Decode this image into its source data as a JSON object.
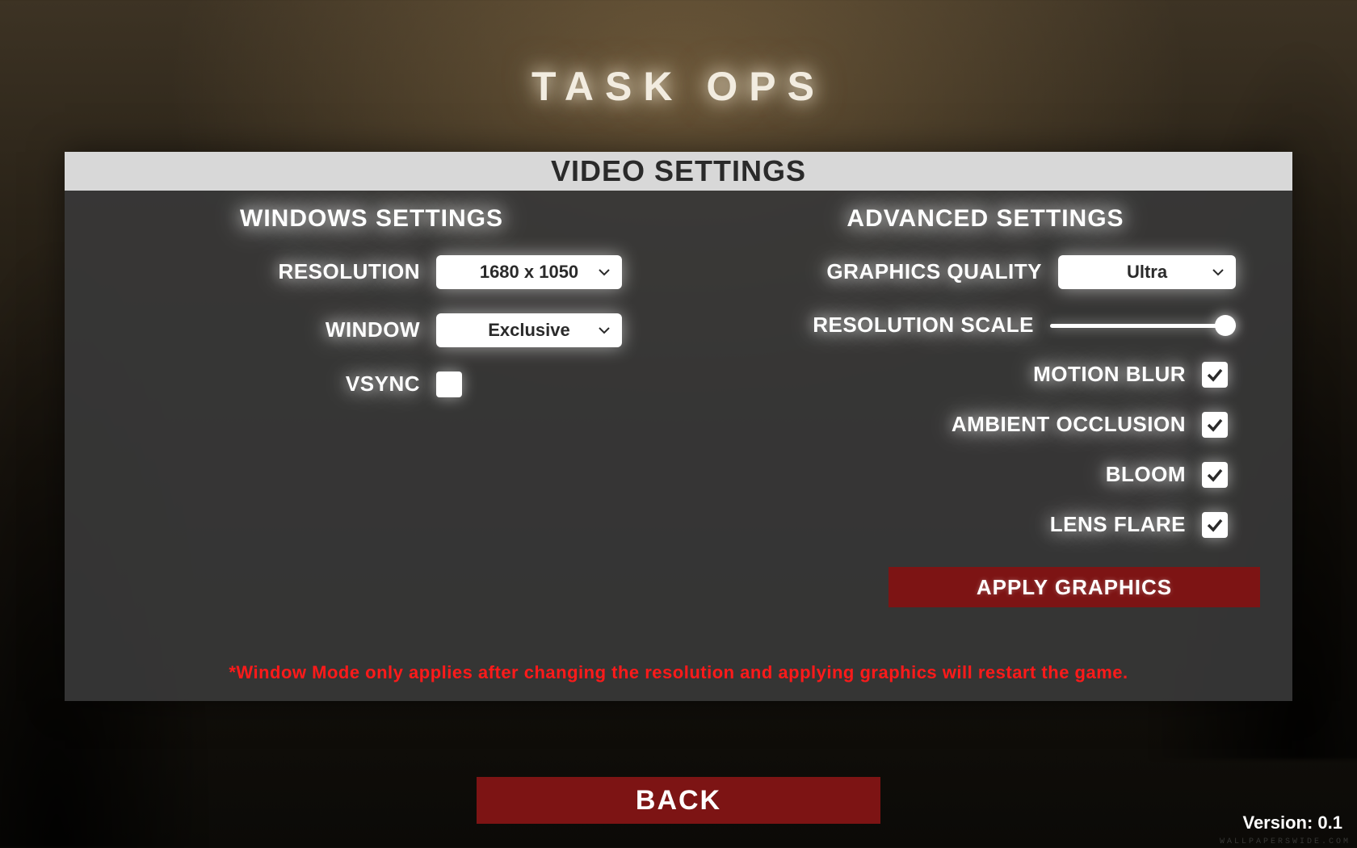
{
  "game_title": "TASK OPS",
  "panel_title": "VIDEO SETTINGS",
  "left": {
    "section": "WINDOWS SETTINGS",
    "resolution": {
      "label": "RESOLUTION",
      "value": "1680 x 1050"
    },
    "window": {
      "label": "WINDOW",
      "value": "Exclusive"
    },
    "vsync": {
      "label": "VSYNC",
      "checked": false
    }
  },
  "right": {
    "section": "ADVANCED SETTINGS",
    "graphics_quality": {
      "label": "GRAPHICS QUALITY",
      "value": "Ultra"
    },
    "resolution_scale": {
      "label": "RESOLUTION SCALE",
      "value": 100,
      "min": 0,
      "max": 100
    },
    "motion_blur": {
      "label": "MOTION BLUR",
      "checked": true
    },
    "ambient_occlusion": {
      "label": "AMBIENT OCCLUSION",
      "checked": true
    },
    "bloom": {
      "label": "BLOOM",
      "checked": true
    },
    "lens_flare": {
      "label": "LENS FLARE",
      "checked": true
    },
    "apply": "APPLY GRAPHICS"
  },
  "warning": "*Window Mode only applies after changing the resolution and applying graphics will restart the game.",
  "back": "BACK",
  "version_label": "Version: 0.1",
  "watermark": "WALLPAPERSWIDE.COM",
  "colors": {
    "accent": "#7d1414",
    "warn": "#ff1a1a"
  }
}
